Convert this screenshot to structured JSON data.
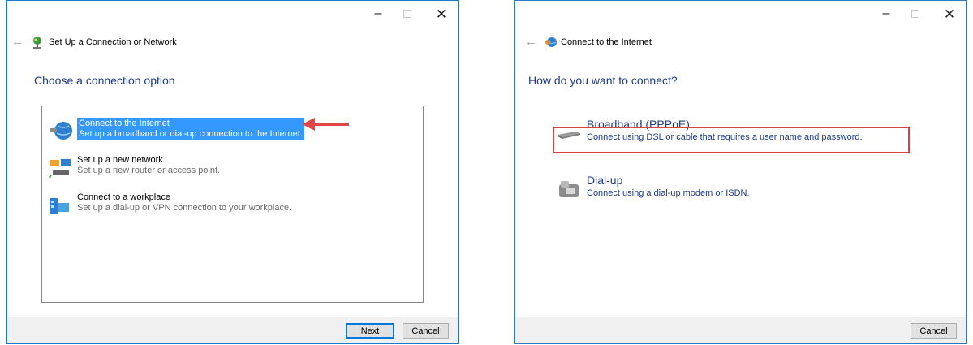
{
  "left_window": {
    "controls": {
      "minimize": "–",
      "close": "✕"
    },
    "nav": {
      "back": "←",
      "title": "Set Up a Connection or Network"
    },
    "heading": "Choose a connection option",
    "options": [
      {
        "title": "Connect to the Internet",
        "desc": "Set up a broadband or dial-up connection to the Internet.",
        "icon": "globe-icon",
        "selected": true
      },
      {
        "title": "Set up a new network",
        "desc": "Set up a new router or access point.",
        "icon": "network-icon",
        "selected": false
      },
      {
        "title": "Connect to a workplace",
        "desc": "Set up a dial-up or VPN connection to your workplace.",
        "icon": "workplace-icon",
        "selected": false
      }
    ],
    "buttons": {
      "next": "Next",
      "cancel": "Cancel"
    }
  },
  "right_window": {
    "controls": {
      "minimize": "–",
      "close": "✕"
    },
    "nav": {
      "back": "←",
      "title": "Connect to the Internet"
    },
    "heading": "How do you want to connect?",
    "options": [
      {
        "title": "Broadband (PPPoE)",
        "desc": "Connect using DSL or cable that requires a user name and password.",
        "icon": "modem-icon"
      },
      {
        "title": "Dial-up",
        "desc": "Connect using a dial-up modem or ISDN.",
        "icon": "dialup-icon"
      }
    ],
    "buttons": {
      "cancel": "Cancel"
    }
  },
  "annotations": {
    "arrow_color": "#e04646",
    "highlight_color": "#d64545"
  }
}
